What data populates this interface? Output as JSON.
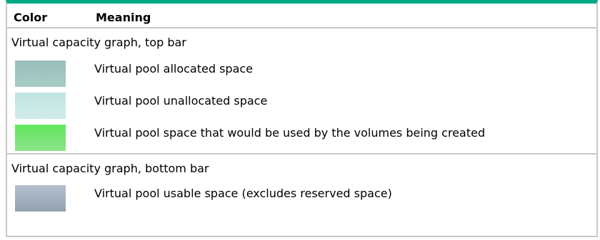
{
  "table": {
    "headers": {
      "color": "Color",
      "meaning": "Meaning"
    },
    "sections": [
      {
        "label": "Virtual capacity graph, top bar",
        "items": [
          {
            "meaning": "Virtual pool allocated space",
            "swatch_colors": [
              "#97bfb8",
              "#a9ccc7"
            ]
          },
          {
            "meaning": "Virtual pool unallocated space",
            "swatch_colors": [
              "#bfe3df",
              "#d1ecea"
            ]
          },
          {
            "meaning": "Virtual pool space that would be used by the volumes being created",
            "swatch_colors": [
              "#5fe65b",
              "#8ee38a"
            ]
          }
        ]
      },
      {
        "label": "Virtual capacity graph, bottom bar",
        "items": [
          {
            "meaning": "Virtual pool usable space (excludes reserved space)",
            "swatch_colors": [
              "#b3c0cc",
              "#93a2b2"
            ]
          }
        ]
      }
    ]
  }
}
